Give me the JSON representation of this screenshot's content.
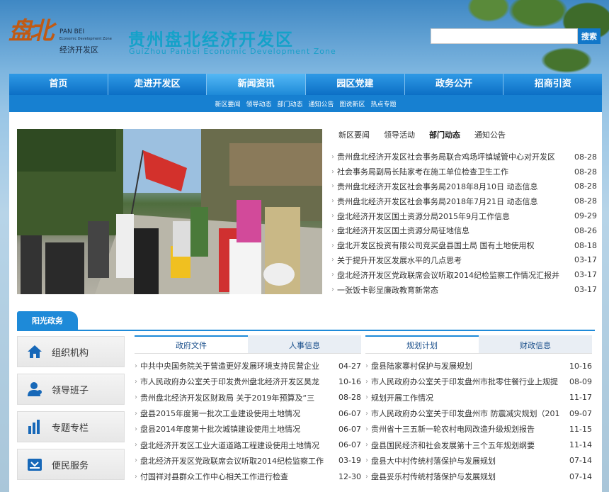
{
  "header": {
    "logo_glyph": "盘北",
    "logo_en": "PAN BEI",
    "logo_en_small": "Economic Development Zone",
    "logo_cn": "经济开发区",
    "title": "贵州盘北经济开发区",
    "subtitle": "GuiZhou Panbei Economic Development Zone",
    "search_placeholder": "",
    "search_label": "搜索"
  },
  "nav": {
    "items": [
      "首页",
      "走进开发区",
      "新闻资讯",
      "园区党建",
      "政务公开",
      "招商引资"
    ],
    "active_index": 2
  },
  "subnav": {
    "items": [
      "新区要闻",
      "领导动态",
      "部门动态",
      "通知公告",
      "图说新区",
      "热点专题"
    ]
  },
  "news": {
    "tabs": [
      "新区要闻",
      "领导活动",
      "部门动态",
      "通知公告"
    ],
    "active_tab": 2,
    "items": [
      {
        "title": "贵州盘北经济开发区社会事务局联合鸡场坪镇城管中心对开发区",
        "date": "08-28"
      },
      {
        "title": "社会事务局副局长陆家考在施工单位检查卫生工作",
        "date": "08-28"
      },
      {
        "title": "贵州盘北经济开发区社会事务局2018年8月10日 动态信息",
        "date": "08-28"
      },
      {
        "title": "贵州盘北经济开发区社会事务局2018年7月21日 动态信息",
        "date": "08-28"
      },
      {
        "title": "盘北经济开发区国土资源分局2015年9月工作信息",
        "date": "09-29"
      },
      {
        "title": "盘北经济开发区国土资源分局征地信息",
        "date": "08-26"
      },
      {
        "title": "盘北开发区投资有限公司竞买盘县国土局 国有土地使用权",
        "date": "08-18"
      },
      {
        "title": "关于提升开发区发展水平的几点思考",
        "date": "03-17"
      },
      {
        "title": "盘北经济开发区党政联席会议听取2014纪检监察工作情况汇报并",
        "date": "03-17"
      },
      {
        "title": "一张饭卡彰显廉政教育新常态",
        "date": "03-17"
      }
    ]
  },
  "section": {
    "title": "阳光政务"
  },
  "side_buttons": [
    {
      "label": "组织机构",
      "icon": "home-icon"
    },
    {
      "label": "领导班子",
      "icon": "user-icon"
    },
    {
      "label": "专题专栏",
      "icon": "bar-chart-icon"
    },
    {
      "label": "便民服务",
      "icon": "inbox-icon"
    }
  ],
  "docs_left": {
    "tabs": [
      "政府文件",
      "人事信息"
    ],
    "active_tab": 0,
    "items": [
      {
        "title": "中共中央国务院关于营造更好发展环境支持民营企业",
        "date": "04-27"
      },
      {
        "title": "市人民政府办公室关于印发贵州盘北经济开发区昊龙",
        "date": "10-16"
      },
      {
        "title": "贵州盘北经济开发区财政局 关于2019年预算及“三",
        "date": "08-28"
      },
      {
        "title": "盘县2015年度第一批次工业建设使用土地情况",
        "date": "06-07"
      },
      {
        "title": "盘县2014年度第十批次城镇建设使用土地情况",
        "date": "06-07"
      },
      {
        "title": "盘北经济开发区工业大道道路工程建设使用土地情况",
        "date": "06-07"
      },
      {
        "title": "盘北经济开发区党政联席会议听取2014纪检监察工作",
        "date": "03-19"
      },
      {
        "title": "付国祥对县群众工作中心相关工作进行检查",
        "date": "12-30"
      }
    ]
  },
  "docs_right": {
    "tabs": [
      "规划计划",
      "财政信息"
    ],
    "active_tab": 0,
    "items": [
      {
        "title": "盘县陆家寨村保护与发展规划",
        "date": "10-16"
      },
      {
        "title": "市人民政府办公室关于印发盘州市批零住餐行业上规提",
        "date": "08-09"
      },
      {
        "title": "规划开展工作情况",
        "date": "11-17"
      },
      {
        "title": "市人民政府办公室关于印发盘州市 防震减灾规划（201",
        "date": "09-07"
      },
      {
        "title": "贵州省十三五新一轮农村电网改造升级规划报告",
        "date": "11-15"
      },
      {
        "title": "盘县国民经济和社会发展第十三个五年规划纲要",
        "date": "11-14"
      },
      {
        "title": "盘县大中村传统村落保护与发展规划",
        "date": "07-14"
      },
      {
        "title": "盘县妥乐村传统村落保护与发展规划",
        "date": "07-14"
      }
    ]
  },
  "colors": {
    "nav_blue": "#0c6fc5",
    "accent": "#1e8ad8",
    "title_cyan": "#14a2c9",
    "logo_orange": "#c05a14"
  }
}
